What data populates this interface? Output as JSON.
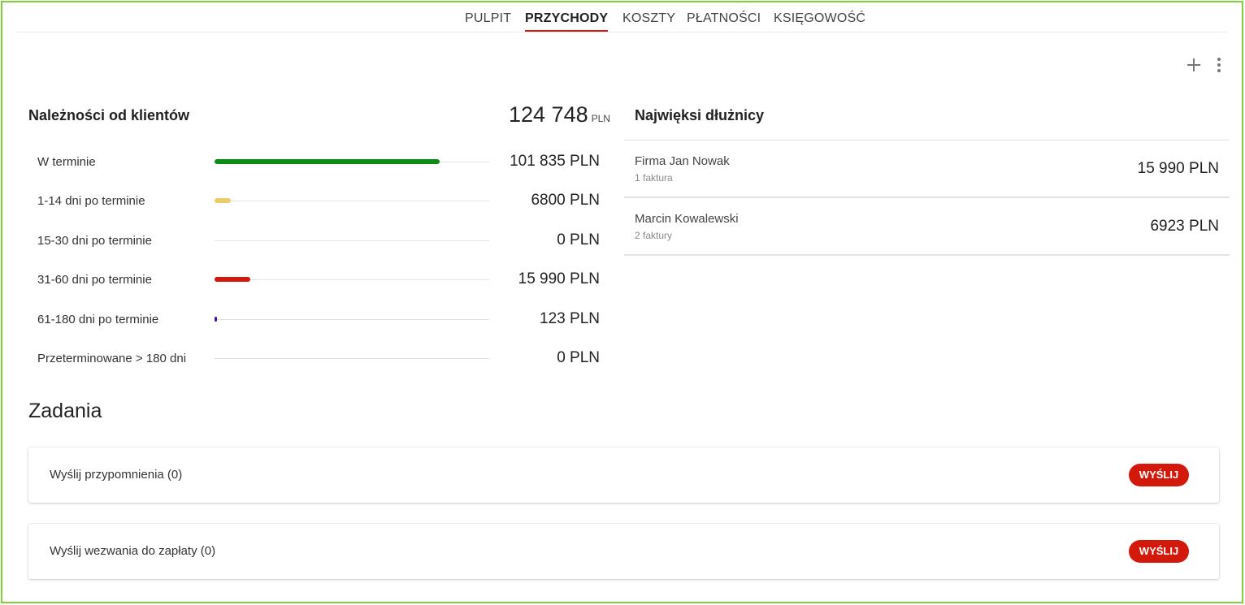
{
  "tabs": [
    {
      "label": "PULPIT",
      "active": false
    },
    {
      "label": "PRZYCHODY",
      "active": true
    },
    {
      "label": "KOSZTY",
      "active": false
    },
    {
      "label": "PŁATNOŚCI",
      "active": false
    },
    {
      "label": "KSIĘGOWOŚĆ",
      "active": false
    }
  ],
  "toolbar": {
    "add_icon": "plus-icon",
    "more_icon": "vertical-dots-icon"
  },
  "receivables": {
    "title": "Należności od klientów",
    "total_amount": "124 748",
    "total_currency": "PLN",
    "rows": [
      {
        "label": "W terminie",
        "amount": "101 835 PLN",
        "bar_fraction": 0.82,
        "color": "#0e8a16"
      },
      {
        "label": "1-14 dni po terminie",
        "amount": "6800 PLN",
        "bar_fraction": 0.06,
        "color": "#eccd6b"
      },
      {
        "label": "15-30 dni po terminie",
        "amount": "0 PLN",
        "bar_fraction": 0,
        "color": "#e3e3e3"
      },
      {
        "label": "31-60 dni po terminie",
        "amount": "15 990 PLN",
        "bar_fraction": 0.13,
        "color": "#d2190b"
      },
      {
        "label": "61-180 dni po terminie",
        "amount": "123 PLN",
        "bar_fraction": 0.008,
        "color": "#4a0aa8"
      },
      {
        "label": "Przeterminowane > 180 dni",
        "amount": "0 PLN",
        "bar_fraction": 0,
        "color": "#e3e3e3"
      }
    ]
  },
  "debtors": {
    "title": "Najwięksi dłużnicy",
    "items": [
      {
        "name": "Firma Jan Nowak",
        "invoices": "1 faktura",
        "amount": "15 990 PLN"
      },
      {
        "name": "Marcin Kowalewski",
        "invoices": "2 faktury",
        "amount": "6923 PLN"
      }
    ]
  },
  "tasks": {
    "title": "Zadania",
    "items": [
      {
        "label": "Wyślij przypomnienia (0)",
        "button": "WYŚLIJ"
      },
      {
        "label": "Wyślij wezwania do zapłaty (0)",
        "button": "WYŚLIJ"
      }
    ]
  },
  "colors": {
    "accent": "#d2190b",
    "frame": "#7fd13b"
  }
}
